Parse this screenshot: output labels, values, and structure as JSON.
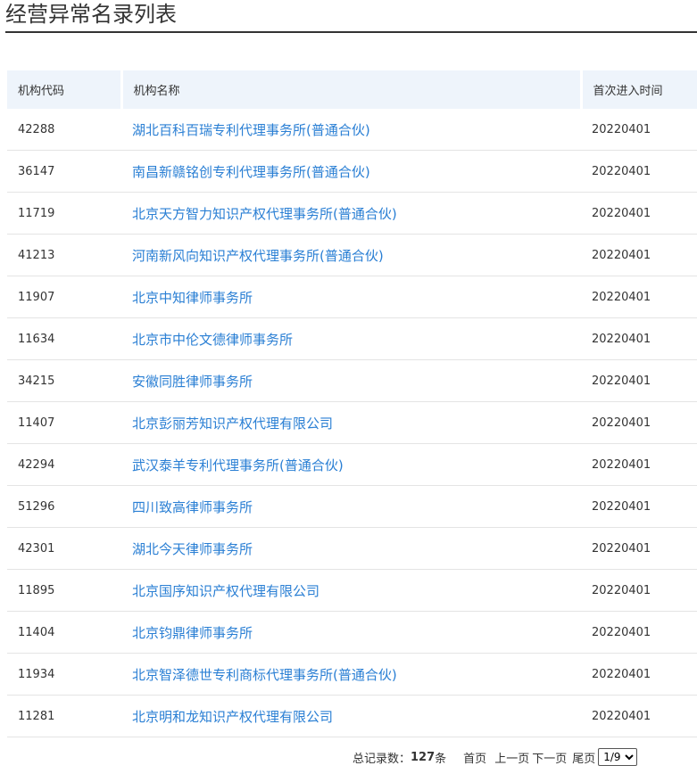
{
  "page": {
    "title": "经营异常名录列表"
  },
  "table": {
    "headers": {
      "code": "机构代码",
      "name": "机构名称",
      "date": "首次进入时间"
    },
    "rows": [
      {
        "code": "42288",
        "name": "湖北百科百瑞专利代理事务所(普通合伙)",
        "date": "20220401"
      },
      {
        "code": "36147",
        "name": "南昌新赣铭创专利代理事务所(普通合伙)",
        "date": "20220401"
      },
      {
        "code": "11719",
        "name": "北京天方智力知识产权代理事务所(普通合伙)",
        "date": "20220401"
      },
      {
        "code": "41213",
        "name": "河南新风向知识产权代理事务所(普通合伙)",
        "date": "20220401"
      },
      {
        "code": "11907",
        "name": "北京中知律师事务所",
        "date": "20220401"
      },
      {
        "code": "11634",
        "name": "北京市中伦文德律师事务所",
        "date": "20220401"
      },
      {
        "code": "34215",
        "name": "安徽同胜律师事务所",
        "date": "20220401"
      },
      {
        "code": "11407",
        "name": "北京彭丽芳知识产权代理有限公司",
        "date": "20220401"
      },
      {
        "code": "42294",
        "name": "武汉泰羊专利代理事务所(普通合伙)",
        "date": "20220401"
      },
      {
        "code": "51296",
        "name": "四川致高律师事务所",
        "date": "20220401"
      },
      {
        "code": "42301",
        "name": "湖北今天律师事务所",
        "date": "20220401"
      },
      {
        "code": "11895",
        "name": "北京国序知识产权代理有限公司",
        "date": "20220401"
      },
      {
        "code": "11404",
        "name": "北京钧鼎律师事务所",
        "date": "20220401"
      },
      {
        "code": "11934",
        "name": "北京智泽德世专利商标代理事务所(普通合伙)",
        "date": "20220401"
      },
      {
        "code": "11281",
        "name": "北京明和龙知识产权代理有限公司",
        "date": "20220401"
      }
    ]
  },
  "pager": {
    "total_label": "总记录数：",
    "total_count": "127",
    "total_unit": "条",
    "first": "首页",
    "prev": "上一页",
    "next": "下一页",
    "last": "尾页",
    "selected_page": "1/9"
  },
  "colors": {
    "link": "#2a7fd4",
    "header_bg": "#eef4fb",
    "rule": "#333333"
  }
}
